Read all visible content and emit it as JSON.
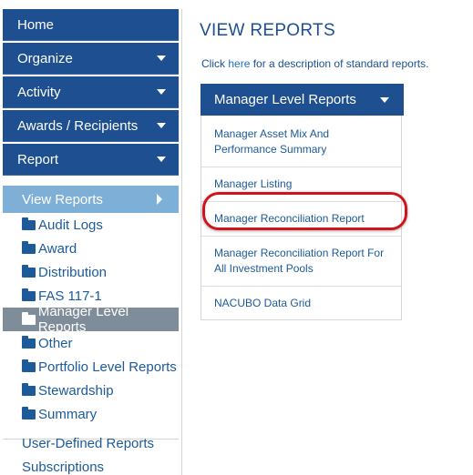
{
  "sidebar": {
    "nav": [
      {
        "label": "Home",
        "caret": false
      },
      {
        "label": "Organize",
        "caret": true
      },
      {
        "label": "Activity",
        "caret": true
      },
      {
        "label": "Awards / Recipients",
        "caret": true
      },
      {
        "label": "Report",
        "caret": true
      }
    ],
    "sub_head": "View Reports",
    "folders": [
      {
        "label": "Audit Logs"
      },
      {
        "label": "Award"
      },
      {
        "label": "Distribution"
      },
      {
        "label": "FAS 117-1"
      },
      {
        "label": "Manager Level Reports",
        "active": true
      },
      {
        "label": "Other"
      },
      {
        "label": "Portfolio Level Reports"
      },
      {
        "label": "Stewardship"
      },
      {
        "label": "Summary"
      }
    ],
    "links": [
      "User-Defined Reports",
      "Subscriptions"
    ]
  },
  "main": {
    "title": "VIEW REPORTS",
    "intro_prefix": "Click ",
    "intro_link": "here",
    "intro_suffix": " for a description of standard reports.",
    "panel": {
      "title": "Manager Level Reports",
      "reports": [
        "Manager Asset Mix And Performance Summary",
        "Manager Listing",
        "Manager Reconciliation Report",
        "Manager Reconciliation Report For All Investment Pools",
        "NACUBO Data Grid"
      ]
    }
  },
  "colors": {
    "nav_bg": "#1d4f91",
    "sub_head_bg": "#7eafd6",
    "active_folder_bg": "#7f8c9a",
    "link": "#1c5a99",
    "highlight": "#d0141b"
  }
}
